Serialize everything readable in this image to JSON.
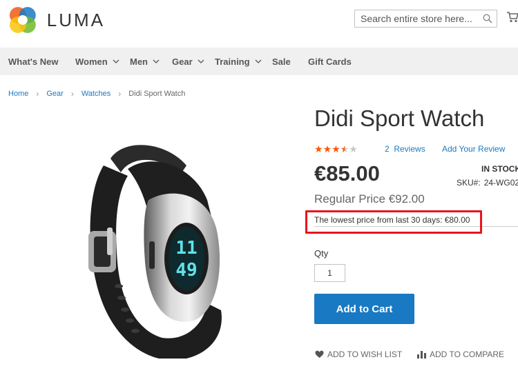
{
  "header": {
    "logo_text": "LUMA",
    "search_placeholder": "Search entire store here...",
    "icons": [
      "luma-logo",
      "search-icon",
      "cart-icon"
    ]
  },
  "nav": {
    "items": [
      {
        "label": "What's New",
        "has_caret": false
      },
      {
        "label": "Women",
        "has_caret": true
      },
      {
        "label": "Men",
        "has_caret": true
      },
      {
        "label": "Gear",
        "has_caret": true
      },
      {
        "label": "Training",
        "has_caret": true
      },
      {
        "label": "Sale",
        "has_caret": false
      },
      {
        "label": "Gift Cards",
        "has_caret": false
      }
    ]
  },
  "breadcrumb": {
    "items": [
      "Home",
      "Gear",
      "Watches"
    ],
    "current": "Didi Sport Watch",
    "separator": "›"
  },
  "product": {
    "title": "Didi Sport Watch",
    "rating": {
      "value": 3.5,
      "max": 5
    },
    "reviews_link": "2  Reviews",
    "add_review_link": "Add Your Review",
    "price": "€85.00",
    "stock": "IN STOCK",
    "sku_label": "SKU#:",
    "sku_value": "24-WG02",
    "regular_price": "Regular Price €92.00",
    "lowest_price": "The lowest price from last 30 days: €80.00",
    "qty_label": "Qty",
    "qty_value": "1",
    "add_to_cart": "Add to Cart",
    "wishlist": "ADD TO WISH LIST",
    "compare": "ADD TO COMPARE",
    "watch_display": [
      "11",
      "49"
    ]
  },
  "colors": {
    "accent_blue": "#1979c3",
    "star_orange": "#ff5501",
    "highlight_red": "#e8141c",
    "nav_bg": "#f0f0f0"
  }
}
